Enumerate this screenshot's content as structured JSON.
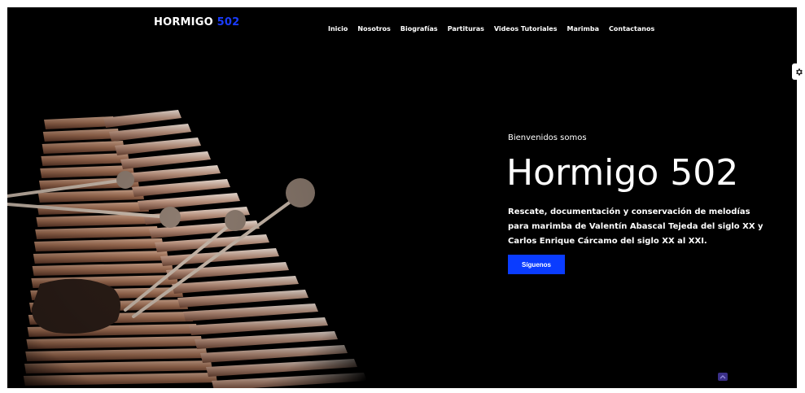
{
  "brand": {
    "name": "HORMIGO",
    "accent": "502",
    "accent_color": "#1a3cff"
  },
  "nav": {
    "items": [
      {
        "label": "Inicio"
      },
      {
        "label": "Nosotros"
      },
      {
        "label": "Biografías"
      },
      {
        "label": "Partituras"
      },
      {
        "label": "Videos Tutoriales"
      },
      {
        "label": "Marimba"
      },
      {
        "label": "Contactanos"
      }
    ]
  },
  "hero": {
    "kicker": "Bienvenidos somos",
    "title": "Hormigo 502",
    "description": "Rescate, documentación y conservación de melodías para marimba de Valentín Abascal Tejeda del siglo XX y Carlos Enrique Cárcamo del siglo XX al XXI.",
    "cta_label": "Síguenos",
    "image_subject": "marimba with mallets"
  },
  "widgets": {
    "settings_icon": "gear-icon",
    "back_to_top_icon": "chevron-up-icon"
  },
  "colors": {
    "background": "#000000",
    "primary": "#0a3cff",
    "text": "#ffffff"
  }
}
